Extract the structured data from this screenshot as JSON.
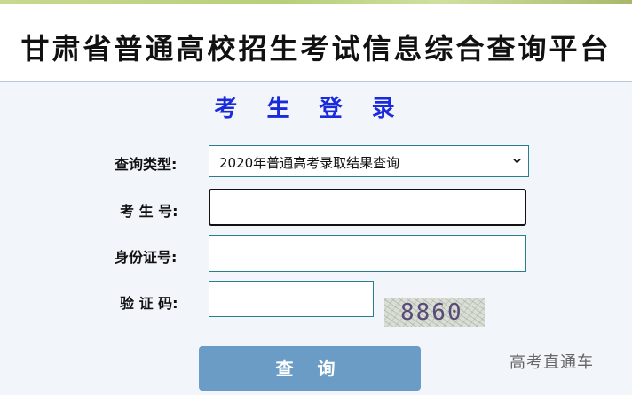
{
  "header": {
    "title": "甘肃省普通高校招生考试信息综合查询平台"
  },
  "login": {
    "title": "考 生 登 录",
    "query_type": {
      "label": "查询类型:",
      "selected": "2020年普通高考录取结果查询"
    },
    "exam_no": {
      "label": "考 生 号:",
      "value": ""
    },
    "id_no": {
      "label": "身份证号:",
      "value": ""
    },
    "captcha": {
      "label": "验 证 码:",
      "value": "",
      "image_text": "8860"
    },
    "submit_label": "查 询"
  },
  "watermark": "高考直通车",
  "colors": {
    "title_blue": "#1a2bdc",
    "button": "#6a9cc5",
    "input_border": "#2a7d8a"
  }
}
